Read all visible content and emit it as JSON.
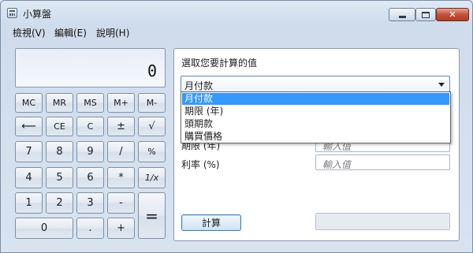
{
  "window": {
    "title": "小算盤",
    "controls": {
      "minimize": "",
      "maximize": "",
      "close": "✕"
    }
  },
  "menu": [
    {
      "label": "檢視(V)"
    },
    {
      "label": "編輯(E)"
    },
    {
      "label": "說明(H)"
    }
  ],
  "calculator": {
    "display": "0",
    "keys": {
      "mc": "MC",
      "mr": "MR",
      "ms": "MS",
      "mplus": "M+",
      "mminus": "M-",
      "backspace": "⟵",
      "ce": "CE",
      "c": "C",
      "sign": "±",
      "sqrt": "√",
      "d7": "7",
      "d8": "8",
      "d9": "9",
      "divide": "/",
      "percent": "%",
      "d4": "4",
      "d5": "5",
      "d6": "6",
      "multiply": "*",
      "reciprocal": "1/x",
      "d1": "1",
      "d2": "2",
      "d3": "3",
      "minus": "-",
      "equals": "=",
      "d0": "0",
      "dot": ".",
      "plus": "+"
    }
  },
  "worksheet": {
    "label": "選取您要計算的值",
    "selected": "月付款",
    "options": [
      "月付款",
      "期限 (年)",
      "頭期款",
      "購買價格"
    ],
    "fields": [
      {
        "label": "期限 (年)",
        "placeholder": "輸入值"
      },
      {
        "label": "利率 (%)",
        "placeholder": "輸入值"
      }
    ],
    "calculate_label": "計算",
    "result": ""
  },
  "colors": {
    "selection": "#3399ff",
    "close_button": "#c4513a",
    "panel_border": "#8a9ab0"
  }
}
